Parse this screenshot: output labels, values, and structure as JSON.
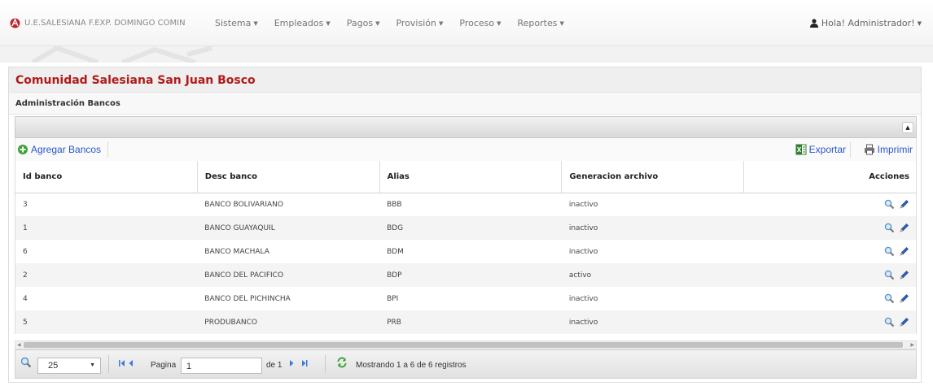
{
  "navbar": {
    "brand": "U.E.SALESIANA F.EXP. DOMINGO COMIN",
    "menu": [
      {
        "label": "Sistema"
      },
      {
        "label": "Empleados"
      },
      {
        "label": "Pagos"
      },
      {
        "label": "Provisión"
      },
      {
        "label": "Proceso"
      },
      {
        "label": "Reportes"
      }
    ],
    "user": "Hola! Administrador!"
  },
  "panel": {
    "title": "Comunidad Salesiana San Juan Bosco",
    "subtitle": "Administración Bancos"
  },
  "toolbar": {
    "add_label": "Agregar Bancos",
    "export_label": "Exportar",
    "print_label": "Imprimir"
  },
  "table": {
    "columns": [
      "Id banco",
      "Desc banco",
      "Alias",
      "Generacion archivo",
      "Acciones"
    ],
    "rows": [
      {
        "id": "3",
        "desc": "BANCO BOLIVARIANO",
        "alias": "BBB",
        "gen": "inactivo"
      },
      {
        "id": "1",
        "desc": "BANCO GUAYAQUIL",
        "alias": "BDG",
        "gen": "inactivo"
      },
      {
        "id": "6",
        "desc": "BANCO MACHALA",
        "alias": "BDM",
        "gen": "inactivo"
      },
      {
        "id": "2",
        "desc": "BANCO DEL PACIFICO",
        "alias": "BDP",
        "gen": "activo"
      },
      {
        "id": "4",
        "desc": "BANCO DEL PICHINCHA",
        "alias": "BPI",
        "gen": "inactivo"
      },
      {
        "id": "5",
        "desc": "PRODUBANCO",
        "alias": "PRB",
        "gen": "inactivo"
      }
    ]
  },
  "pager": {
    "page_size": "25",
    "page_label": "Pagina",
    "page_value": "1",
    "of_label": "de 1",
    "info": "Mostrando 1 a 6 de 6 registros"
  },
  "icons": {
    "brand": "bosco-logo-icon",
    "user": "user-icon",
    "add": "plus-circle-icon",
    "export": "excel-icon",
    "print": "printer-icon",
    "view": "magnifier-icon",
    "edit": "pencil-icon"
  },
  "colors": {
    "title": "#b01a1a",
    "link": "#2a57c6"
  }
}
